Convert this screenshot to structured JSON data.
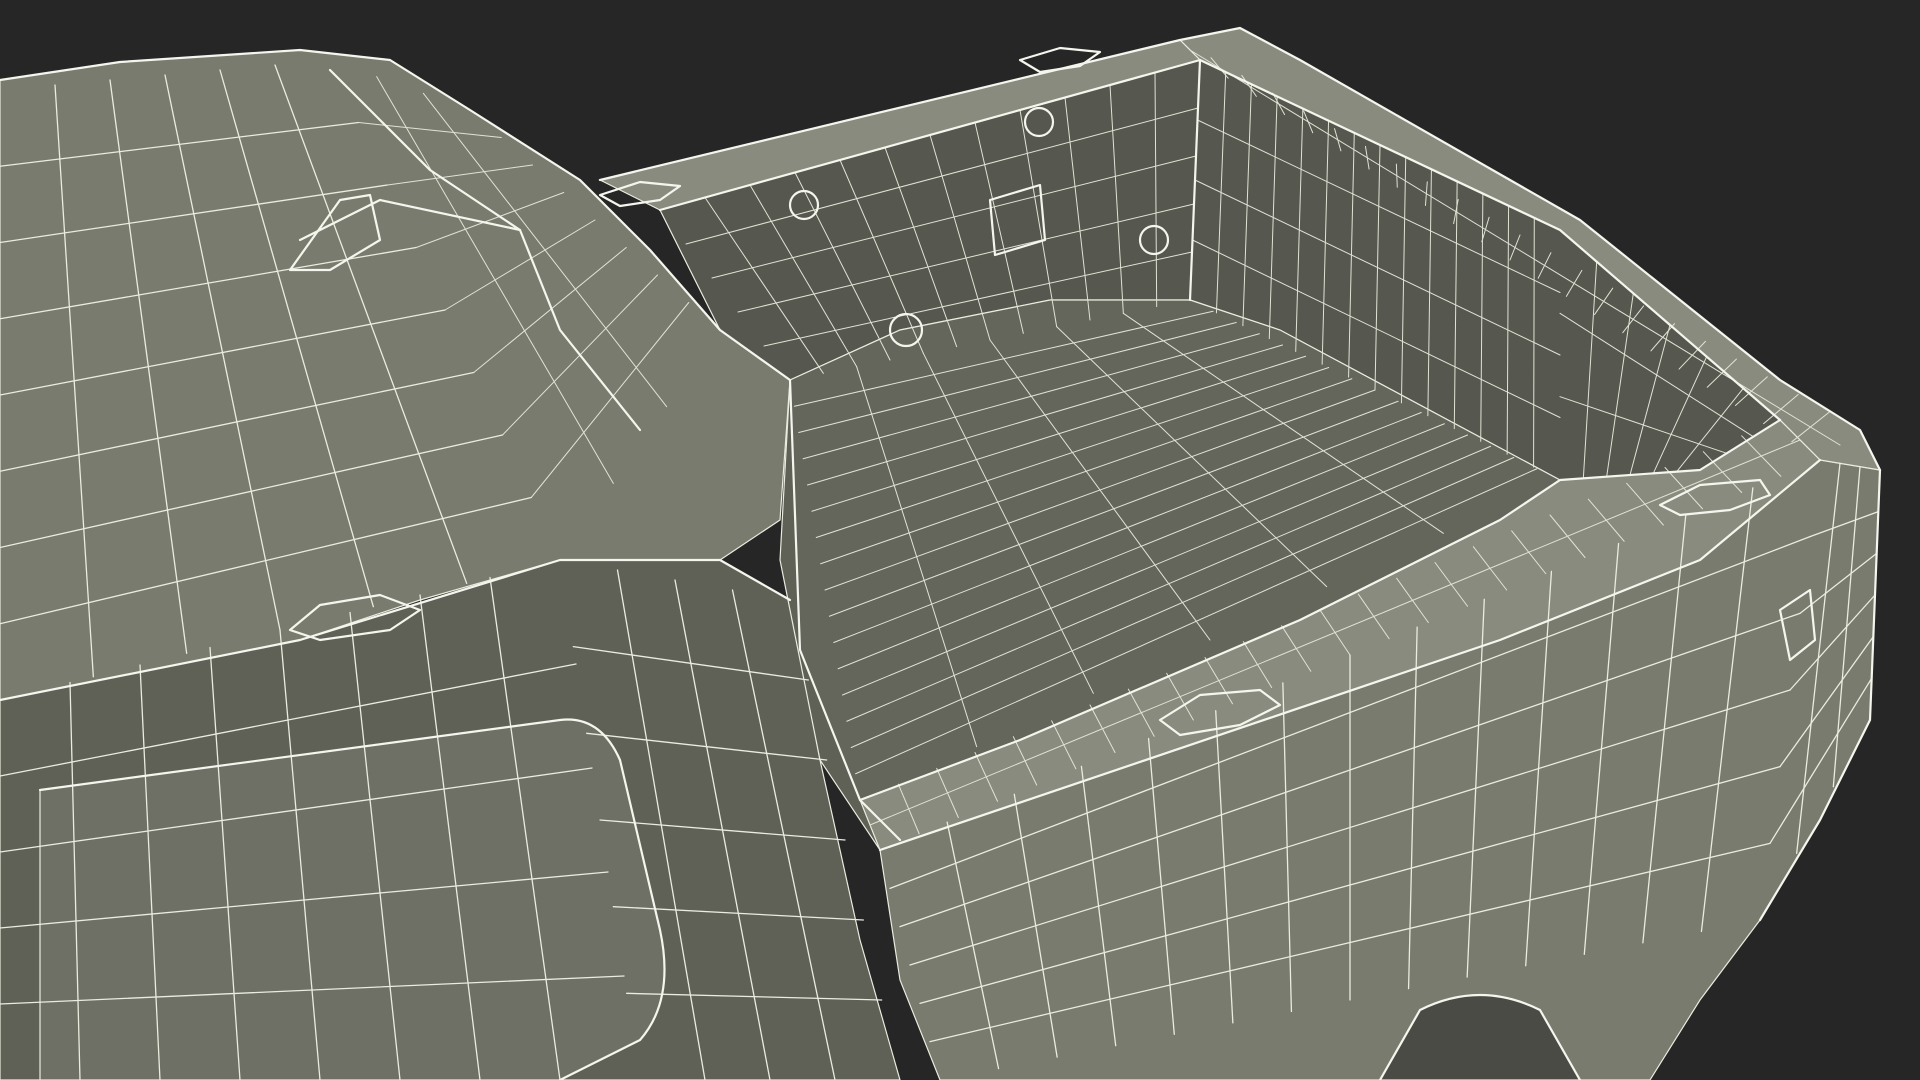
{
  "scene": {
    "subject": "pickup-truck-wireframe-render",
    "colors": {
      "background": "#262626",
      "body_surface": "#7a7b6f",
      "body_surface_light": "#8a8b7f",
      "body_surface_dark": "#5f6157",
      "bed_floor": "#64665c",
      "bed_wall": "#56584f",
      "window_glass": "#6e6f65",
      "wire": "#e9ecdf",
      "tire": "#4a4b45"
    }
  }
}
